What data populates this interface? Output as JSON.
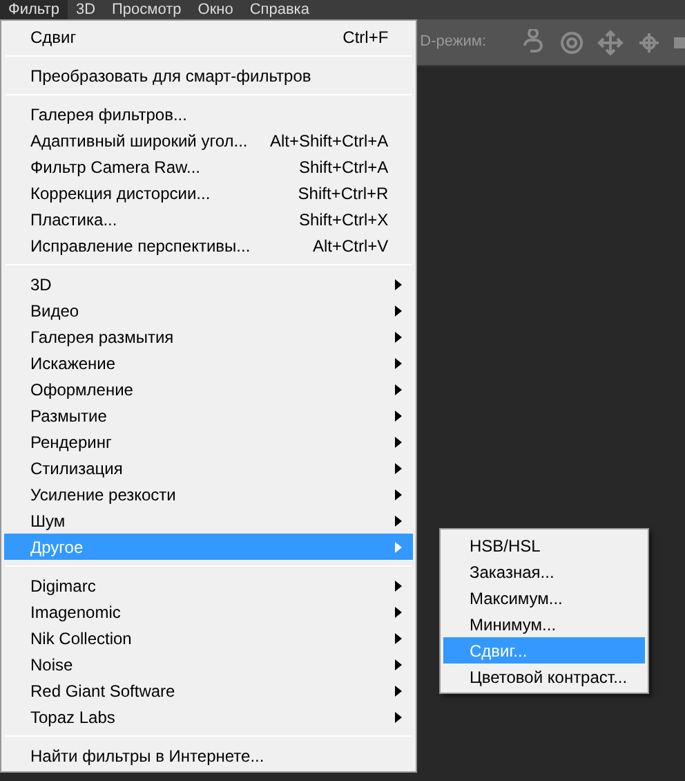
{
  "menubar": [
    {
      "label": "Фильтр",
      "selected": true
    },
    {
      "label": "3D",
      "selected": false
    },
    {
      "label": "Просмотр",
      "selected": false
    },
    {
      "label": "Окно",
      "selected": false
    },
    {
      "label": "Справка",
      "selected": false
    }
  ],
  "toolbar": {
    "label": "D-режим:"
  },
  "menu": {
    "groups": [
      [
        {
          "label": "Сдвиг",
          "shortcut": "Ctrl+F",
          "submenu": false,
          "selected": false
        }
      ],
      [
        {
          "label": "Преобразовать для смарт-фильтров",
          "submenu": false,
          "selected": false
        }
      ],
      [
        {
          "label": "Галерея фильтров...",
          "submenu": false,
          "selected": false
        },
        {
          "label": "Адаптивный широкий угол...",
          "shortcut": "Alt+Shift+Ctrl+A",
          "submenu": false,
          "selected": false
        },
        {
          "label": "Фильтр Camera Raw...",
          "shortcut": "Shift+Ctrl+A",
          "submenu": false,
          "selected": false
        },
        {
          "label": "Коррекция дисторсии...",
          "shortcut": "Shift+Ctrl+R",
          "submenu": false,
          "selected": false
        },
        {
          "label": "Пластика...",
          "shortcut": "Shift+Ctrl+X",
          "submenu": false,
          "selected": false
        },
        {
          "label": "Исправление перспективы...",
          "shortcut": "Alt+Ctrl+V",
          "submenu": false,
          "selected": false
        }
      ],
      [
        {
          "label": "3D",
          "submenu": true,
          "selected": false
        },
        {
          "label": "Видео",
          "submenu": true,
          "selected": false
        },
        {
          "label": "Галерея размытия",
          "submenu": true,
          "selected": false
        },
        {
          "label": "Искажение",
          "submenu": true,
          "selected": false
        },
        {
          "label": "Оформление",
          "submenu": true,
          "selected": false
        },
        {
          "label": "Размытие",
          "submenu": true,
          "selected": false
        },
        {
          "label": "Рендеринг",
          "submenu": true,
          "selected": false
        },
        {
          "label": "Стилизация",
          "submenu": true,
          "selected": false
        },
        {
          "label": "Усиление резкости",
          "submenu": true,
          "selected": false
        },
        {
          "label": "Шум",
          "submenu": true,
          "selected": false
        },
        {
          "label": "Другое",
          "submenu": true,
          "selected": true
        }
      ],
      [
        {
          "label": "Digimarc",
          "submenu": true,
          "selected": false
        },
        {
          "label": "Imagenomic",
          "submenu": true,
          "selected": false
        },
        {
          "label": "Nik Collection",
          "submenu": true,
          "selected": false
        },
        {
          "label": "Noise",
          "submenu": true,
          "selected": false
        },
        {
          "label": "Red Giant Software",
          "submenu": true,
          "selected": false
        },
        {
          "label": "Topaz Labs",
          "submenu": true,
          "selected": false
        }
      ],
      [
        {
          "label": "Найти фильтры в Интернете...",
          "submenu": false,
          "selected": false
        }
      ]
    ]
  },
  "submenu": {
    "items": [
      {
        "label": "HSB/HSL",
        "selected": false
      },
      {
        "label": "Заказная...",
        "selected": false
      },
      {
        "label": "Максимум...",
        "selected": false
      },
      {
        "label": "Минимум...",
        "selected": false
      },
      {
        "label": "Сдвиг...",
        "selected": true
      },
      {
        "label": "Цветовой контраст...",
        "selected": false
      }
    ]
  }
}
